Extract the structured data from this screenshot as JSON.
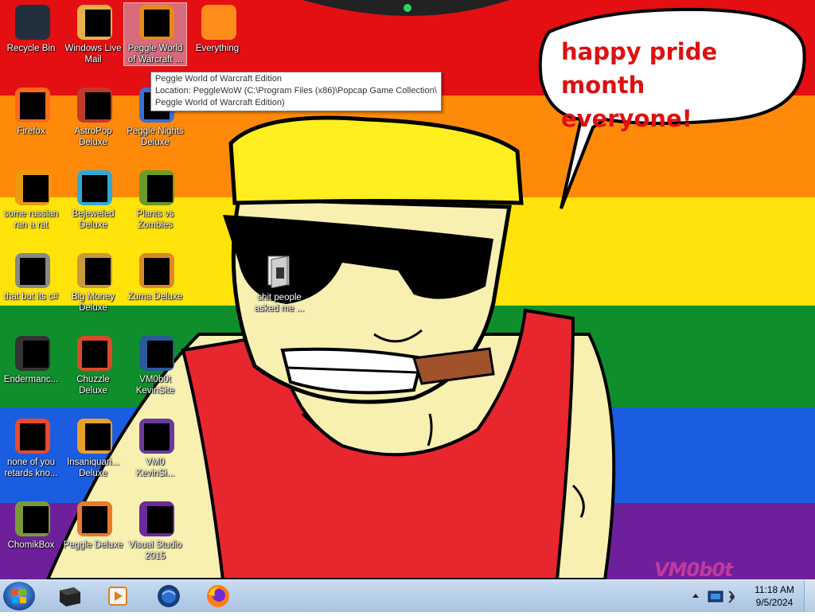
{
  "wallpaper": {
    "colors": [
      "#e30f12",
      "#ff8a0a",
      "#ffe30a",
      "#0e8f2b",
      "#1b5de0",
      "#6e1f9a"
    ],
    "speech_bubble": {
      "line1": "happy pride month",
      "line2": "everyone!"
    },
    "watermark": "VM0b0t"
  },
  "desktop_icons": [
    {
      "label": "Recycle Bin",
      "icon": "recycle-bin-icon",
      "color": "#22303e"
    },
    {
      "label": "Windows Live\nMail",
      "icon": "mail-icon",
      "color": "#e8b04a"
    },
    {
      "label": "Peggle World\nof Warcraft ...",
      "icon": "peggle-icon",
      "color": "#e88a1a",
      "selected": true
    },
    {
      "label": "Everything",
      "icon": "search-icon",
      "color": "#ff8c1a"
    },
    {
      "label": "Firefox",
      "icon": "firefox-icon",
      "color": "#ff6a1a"
    },
    {
      "label": "AstroPop\nDeluxe",
      "icon": "astropop-icon",
      "color": "#c0392b"
    },
    {
      "label": "Peggle Nights\nDeluxe",
      "icon": "peggle-nights-icon",
      "color": "#3a6fd8"
    },
    {
      "label": "some russian\nran a rat",
      "icon": "rat-icon",
      "color": "#e89a10"
    },
    {
      "label": "Bejeweled\nDeluxe",
      "icon": "gem-icon",
      "color": "#2fa8d8"
    },
    {
      "label": "Plants vs\nZombies",
      "icon": "plant-icon",
      "color": "#6a9a2a"
    },
    {
      "label": "that but its c#",
      "icon": "shortcut-icon",
      "color": "#888888"
    },
    {
      "label": "Big Money\nDeluxe",
      "icon": "money-bag-icon",
      "color": "#c89a3a"
    },
    {
      "label": "Zuma Deluxe",
      "icon": "zuma-icon",
      "color": "#d88a2a"
    },
    {
      "label": "Endermanc...",
      "icon": "terminal-icon",
      "color": "#333333"
    },
    {
      "label": "Chuzzle\nDeluxe",
      "icon": "chuzzle-icon",
      "color": "#d84a2a"
    },
    {
      "label": "VM0b0t\nKevinSite",
      "icon": "site-icon",
      "color": "#2a5a9a"
    },
    {
      "label": "none of you\nretards kno...",
      "icon": "app-icon",
      "color": "#e84a2a"
    },
    {
      "label": "Insaniquari...\nDeluxe",
      "icon": "fish-icon",
      "color": "#e8a02a"
    },
    {
      "label": "VM0\nKevinSi...",
      "icon": "csharp-icon",
      "color": "#6a3a9a"
    },
    {
      "label": "ChomikBox",
      "icon": "chomik-icon",
      "color": "#7a9a3a"
    },
    {
      "label": "Peggle Deluxe",
      "icon": "peggle-deluxe-icon",
      "color": "#e87a2a"
    },
    {
      "label": "Visual Studio\n2015",
      "icon": "visual-studio-icon",
      "color": "#6a2a9a"
    }
  ],
  "folder": {
    "label": "shit people\nasked me ...",
    "icon": "folder-icon"
  },
  "tooltip": {
    "line1": "Peggle World of Warcraft Edition",
    "line2": "Location: PeggleWoW (C:\\Program Files (x86)\\Popcap Game Collection\\",
    "line3": "Peggle World of Warcraft Edition)"
  },
  "taskbar": {
    "start_icon": "windows-start-icon",
    "pinned": [
      {
        "name": "computer",
        "icon": "computer-icon"
      },
      {
        "name": "media-player",
        "icon": "media-player-icon"
      },
      {
        "name": "globe",
        "icon": "globe-icon"
      },
      {
        "name": "firefox",
        "icon": "firefox-icon"
      }
    ],
    "clock": {
      "time": "11:18 AM",
      "date": "9/5/2024"
    }
  }
}
